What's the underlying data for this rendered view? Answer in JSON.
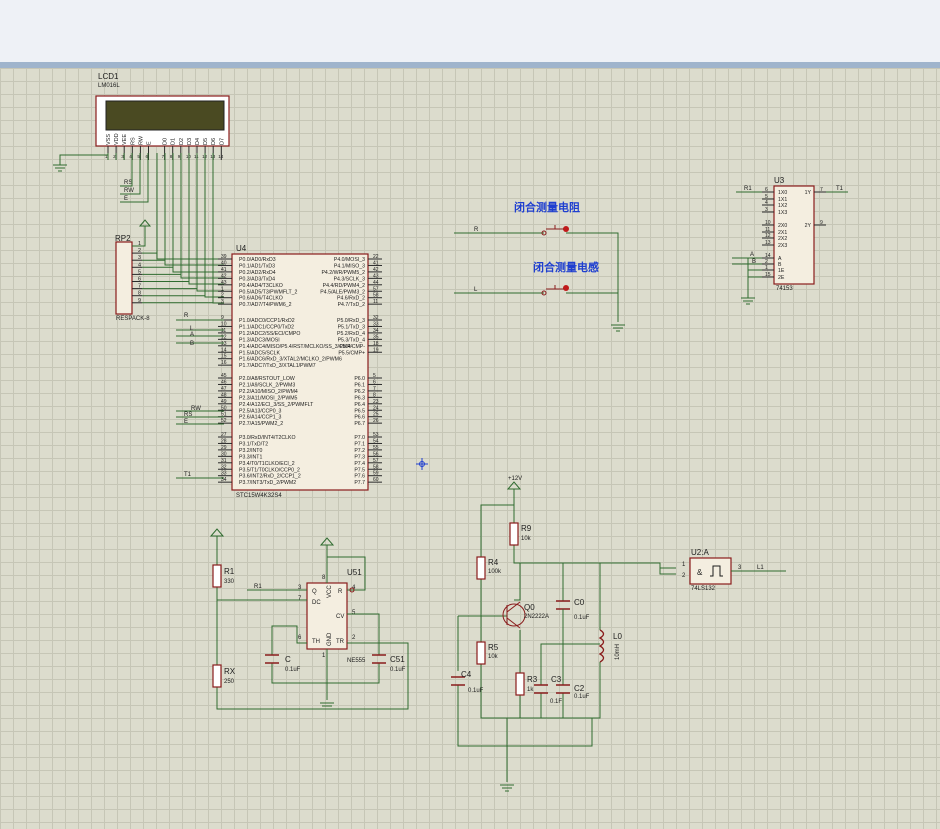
{
  "lcd": {
    "ref": "LCD1",
    "type": "LM016L",
    "pins": [
      "VSS",
      "VDD",
      "VEE",
      "RS",
      "RW",
      "E",
      "D0",
      "D1",
      "D2",
      "D3",
      "D4",
      "D5",
      "D6",
      "D7"
    ],
    "nums": [
      "1",
      "2",
      "3",
      "4",
      "5",
      "6",
      "7",
      "8",
      "9",
      "10",
      "11",
      "12",
      "13",
      "14"
    ],
    "rs": "RS",
    "rw": "RW",
    "e": "E"
  },
  "rp2": {
    "ref": "RP2",
    "type": "RESPACK-8",
    "nums": [
      "1",
      "2",
      "3",
      "4",
      "5",
      "6",
      "7",
      "8",
      "9"
    ]
  },
  "mcu": {
    "ref": "U4",
    "type": "STC15W4K32S4",
    "left": [
      {
        "n": "39",
        "l": "P0.0/AD0/RxD3"
      },
      {
        "n": "40",
        "l": "P0.1/AD1/TxD3"
      },
      {
        "n": "41",
        "l": "P0.2/AD2/RxD4"
      },
      {
        "n": "42",
        "l": "P0.3/AD3/TxD4"
      },
      {
        "n": "43",
        "l": "P0.4/AD4/T3CLKO"
      },
      {
        "n": "1",
        "l": "P0.5/AD5/T3/PWMFLT_2"
      },
      {
        "n": "2",
        "l": "P0.6/AD6/T4CLKO"
      },
      {
        "n": "3",
        "l": "P0.7/AD7/T4/PWM6_2"
      },
      {
        "n": "9",
        "l": "P1.0/ADC0/CCP1/RxD2"
      },
      {
        "n": "10",
        "l": "P1.1/ADC1/CCP0/TxD2"
      },
      {
        "n": "11",
        "l": "P1.2/ADC2/SS/ECI/CMPO"
      },
      {
        "n": "12",
        "l": "P1.3/ADC3/MOSI"
      },
      {
        "n": "13",
        "l": "P1.4/ADC4/MISO/P5.4/RST/MCLKO/SS_3/CMP-"
      },
      {
        "n": "14",
        "l": "P1.5/ADC5/SCLK"
      },
      {
        "n": "15",
        "l": "P1.6/ADC6/RxD_3/XTAL2/MCLKO_2/PWM6"
      },
      {
        "n": "16",
        "l": "P1.7/ADC7/TxD_3/XTAL1/PWM7"
      },
      {
        "n": "45",
        "l": "P2.0/A8/RSTOUT_LOW"
      },
      {
        "n": "46",
        "l": "P2.1/A9/SCLK_2/PWM3"
      },
      {
        "n": "47",
        "l": "P2.2/A10/MISO_2/PWM4"
      },
      {
        "n": "48",
        "l": "P2.3/A11/MOSI_2/PWM5"
      },
      {
        "n": "49",
        "l": "P2.4/A12/ECI_3/SS_2/PWMFLT"
      },
      {
        "n": "50",
        "l": "P2.5/A13/CCP0_3"
      },
      {
        "n": "51",
        "l": "P2.6/A14/CCP1_3"
      },
      {
        "n": "52",
        "l": "P2.7/A15/PWM2_2"
      },
      {
        "n": "27",
        "l": "P3.0/RxD/INT4/T2CLKO"
      },
      {
        "n": "28",
        "l": "P3.1/TxD/T2"
      },
      {
        "n": "29",
        "l": "P3.2/INT0"
      },
      {
        "n": "30",
        "l": "P3.3/INT1"
      },
      {
        "n": "31",
        "l": "P3.4/T0/T1CLKO/ECI_2"
      },
      {
        "n": "32",
        "l": "P3.5/T1/T0CLKO/CCP0_2"
      },
      {
        "n": "33",
        "l": "P3.6/INT2/RxD_2/CCP1_2"
      },
      {
        "n": "34",
        "l": "P3.7/INT3/TxD_2/PWM2"
      }
    ],
    "right": [
      {
        "n": "22",
        "l": "P4.0/MOSI_3"
      },
      {
        "n": "41",
        "l": "P4.1/MISO_3"
      },
      {
        "n": "42",
        "l": "P4.2/WR/PWM5_2"
      },
      {
        "n": "43",
        "l": "P4.3/SCLK_3"
      },
      {
        "n": "44",
        "l": "P4.4/RD/PWM4_2"
      },
      {
        "n": "57",
        "l": "P4.5/ALE/PWM3_2"
      },
      {
        "n": "58",
        "l": "P4.6/RxD_2"
      },
      {
        "n": "11",
        "l": "P4.7/TxD_2"
      },
      {
        "n": "32",
        "l": "P5.0/RxD_3"
      },
      {
        "n": "33",
        "l": "P5.1/TxD_3"
      },
      {
        "n": "34",
        "l": "P5.2/RxD_4"
      },
      {
        "n": "35",
        "l": "P5.3/TxD_4"
      },
      {
        "n": "18",
        "l": "P5.4/CMP-"
      },
      {
        "n": "19",
        "l": "P5.5/CMP+"
      },
      {
        "n": "5",
        "l": "P6.0"
      },
      {
        "n": "6",
        "l": "P6.1"
      },
      {
        "n": "7",
        "l": "P6.2"
      },
      {
        "n": "8",
        "l": "P6.3"
      },
      {
        "n": "23",
        "l": "P6.4"
      },
      {
        "n": "24",
        "l": "P6.5"
      },
      {
        "n": "25",
        "l": "P6.6"
      },
      {
        "n": "26",
        "l": "P6.7"
      },
      {
        "n": "53",
        "l": "P7.0"
      },
      {
        "n": "54",
        "l": "P7.1"
      },
      {
        "n": "55",
        "l": "P7.2"
      },
      {
        "n": "56",
        "l": "P7.3"
      },
      {
        "n": "57",
        "l": "P7.4"
      },
      {
        "n": "58",
        "l": "P7.5"
      },
      {
        "n": "59",
        "l": "P7.6"
      },
      {
        "n": "60",
        "l": "P7.7"
      }
    ],
    "nets": {
      "r": "R",
      "l": "L",
      "a": "A",
      "b": "B",
      "rw": "RW",
      "rs": "RS",
      "e": "E",
      "t1": "T1"
    }
  },
  "switches": {
    "s1_title": "闭合测量电阻",
    "s2_title": "闭合测量电感",
    "net_r": "R",
    "net_l": "L"
  },
  "u3": {
    "ref": "U3",
    "type": "74153",
    "left": [
      {
        "n": "6",
        "l": "1X0"
      },
      {
        "n": "5",
        "l": "1X1"
      },
      {
        "n": "4",
        "l": "1X2"
      },
      {
        "n": "3",
        "l": "1X3"
      },
      {
        "n": "10",
        "l": "2X0"
      },
      {
        "n": "11",
        "l": "2X1"
      },
      {
        "n": "12",
        "l": "2X2"
      },
      {
        "n": "13",
        "l": "2X3"
      },
      {
        "n": "14",
        "l": "A"
      },
      {
        "n": "2",
        "l": "B"
      },
      {
        "n": "1",
        "l": "1E"
      },
      {
        "n": "15",
        "l": "2E"
      }
    ],
    "right": [
      {
        "n": "7",
        "l": "1Y"
      },
      {
        "n": "9",
        "l": "2Y"
      }
    ],
    "net_r1": "R1",
    "net_t1": "T1",
    "net_a": "A",
    "net_b": "B"
  },
  "timer": {
    "ref": "U51",
    "type": "NE555",
    "pins": {
      "gnd": "GND",
      "vcc": "VCC",
      "r": "R",
      "q": "Q",
      "dc": "DC",
      "cv": "CV",
      "th": "TH",
      "tr": "TR"
    },
    "nums": {
      "q": "3",
      "dc": "7",
      "vcc": "8",
      "r": "4",
      "cv": "5",
      "th": "6",
      "tr": "2",
      "gnd": "1"
    },
    "r1": {
      "ref": "R1",
      "val": "330"
    },
    "rx": {
      "ref": "RX",
      "val": "250"
    },
    "c": {
      "ref": "C",
      "val": "0.1uF"
    },
    "c51": {
      "ref": "C51",
      "val": "0.1uF"
    },
    "net_r1": "R1"
  },
  "osc": {
    "vcc": "+12V",
    "r9": {
      "ref": "R9",
      "val": "10k"
    },
    "r4": {
      "ref": "R4",
      "val": "100k"
    },
    "r5": {
      "ref": "R5",
      "val": "10k"
    },
    "r3": {
      "ref": "R3",
      "val": "1k"
    },
    "q0": {
      "ref": "Q0",
      "val": "2N2222A"
    },
    "c0": {
      "ref": "C0",
      "val": "0.1uF"
    },
    "c4": {
      "ref": "C4",
      "val": "0.1uF"
    },
    "c3": {
      "ref": "C3",
      "val": "0.1F"
    },
    "c2": {
      "ref": "C2",
      "val": "0.1uF"
    },
    "l0": {
      "ref": "L0",
      "val": "10mH"
    }
  },
  "gate": {
    "ref": "U2:A",
    "type": "74LS132",
    "in1": "1",
    "in2": "2",
    "out": "3",
    "sym": "&",
    "net_out": "L1"
  }
}
